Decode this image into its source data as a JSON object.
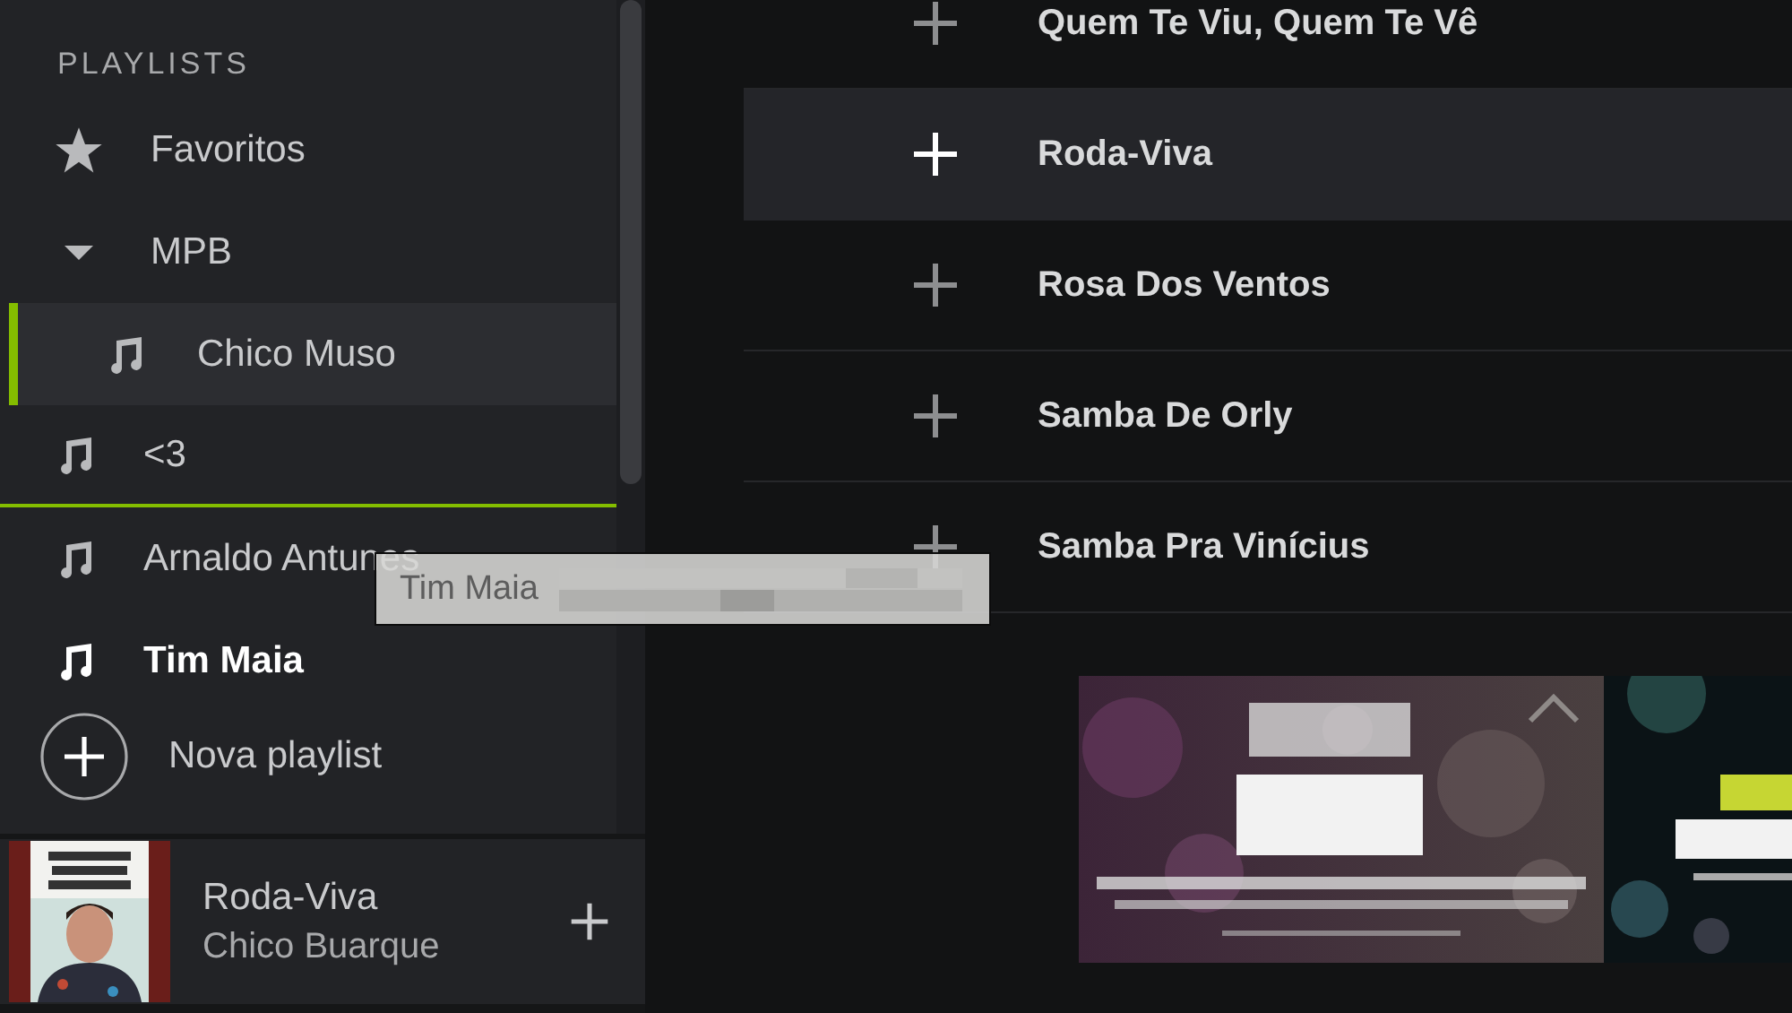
{
  "sidebar": {
    "heading": "PLAYLISTS",
    "items": [
      {
        "kind": "starred",
        "label": "Favoritos",
        "selected": false,
        "playing": false
      },
      {
        "kind": "folder",
        "label": "MPB",
        "expanded": true,
        "selected": false,
        "playing": false,
        "children": [
          {
            "kind": "playlist",
            "label": "Chico Muso",
            "selected": true,
            "playing": false
          }
        ]
      },
      {
        "kind": "playlist",
        "label": "<3",
        "selected": false,
        "playing": false,
        "drop_target": true
      },
      {
        "kind": "playlist",
        "label": "Arnaldo Antunes",
        "selected": false,
        "playing": false
      },
      {
        "kind": "playlist",
        "label": "Tim Maia",
        "selected": false,
        "playing": true
      }
    ],
    "new_playlist": "Nova playlist"
  },
  "drag_ghost": {
    "label": "Tim Maia"
  },
  "now_playing": {
    "title": "Roda-Viva",
    "artist": "Chico Buarque"
  },
  "tracks": [
    {
      "title": "Quem Te Viu, Quem Te Vê",
      "selected": false
    },
    {
      "title": "Roda-Viva",
      "selected": true
    },
    {
      "title": "Rosa Dos Ventos",
      "selected": false
    },
    {
      "title": "Samba De Orly",
      "selected": false
    },
    {
      "title": "Samba Pra Vinícius",
      "selected": false
    }
  ]
}
